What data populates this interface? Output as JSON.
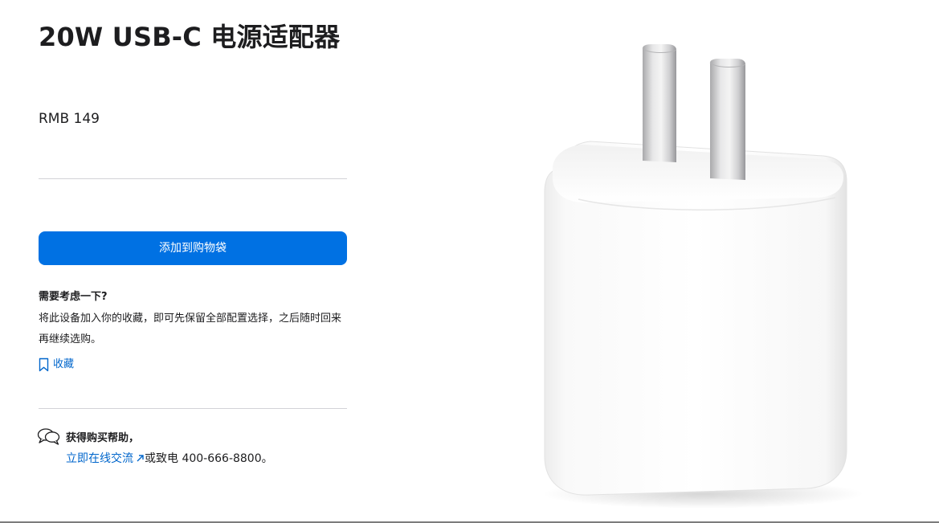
{
  "product": {
    "title": "20W USB-C 电源适配器",
    "price": "RMB 149",
    "image_alt": "20W USB-C 电源适配器"
  },
  "purchase": {
    "add_to_bag_label": "添加到购物袋"
  },
  "consider": {
    "heading": "需要考虑一下?",
    "text": "将此设备加入你的收藏，即可先保留全部配置选择，之后随时回来再继续选购。",
    "favorite_label": "收藏",
    "favorite_icon": "bookmark-icon"
  },
  "help": {
    "icon": "chat-bubbles-icon",
    "heading": "获得购买帮助，",
    "chat_link_label": "立即在线交流",
    "chat_link_icon": "external-arrow-icon",
    "phone_text": "或致电 400-666-8800。"
  },
  "colors": {
    "accent": "#0071e3",
    "link": "#0066cc",
    "text": "#1d1d1f",
    "divider": "#d2d2d7"
  }
}
